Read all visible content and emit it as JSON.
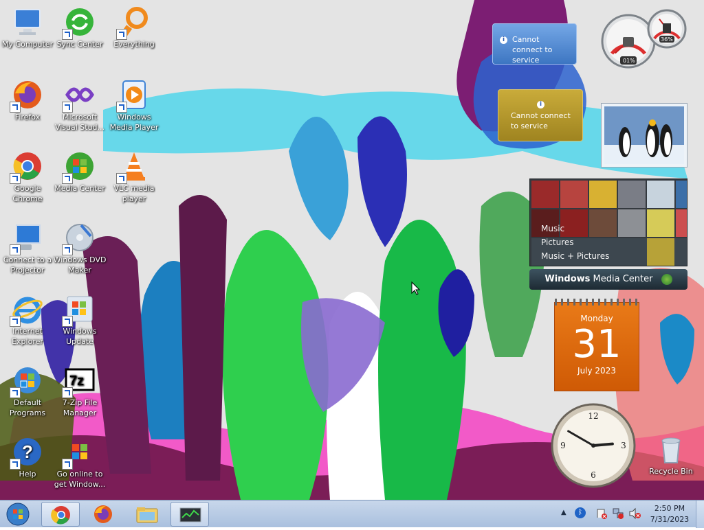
{
  "desktop_icons": [
    {
      "label": "My Computer",
      "icon": "computer-icon"
    },
    {
      "label": "Sync Center",
      "icon": "sync-icon"
    },
    {
      "label": "Everything",
      "icon": "search-ring-icon"
    },
    {
      "label": "Firefox",
      "icon": "firefox-icon"
    },
    {
      "label": "Microsoft Visual Stud...",
      "icon": "visual-studio-icon"
    },
    {
      "label": "Windows Media Player",
      "icon": "media-player-icon"
    },
    {
      "label": "Google Chrome",
      "icon": "chrome-icon"
    },
    {
      "label": "Media Center",
      "icon": "media-center-icon"
    },
    {
      "label": "VLC media player",
      "icon": "vlc-icon"
    },
    {
      "label": "Connect to a Projector",
      "icon": "projector-icon"
    },
    {
      "label": "Windows DVD Maker",
      "icon": "dvd-maker-icon"
    },
    {
      "label": "Internet Explorer",
      "icon": "internet-explorer-icon"
    },
    {
      "label": "Windows Update",
      "icon": "windows-update-icon"
    },
    {
      "label": "Default Programs",
      "icon": "default-programs-icon"
    },
    {
      "label": "7-Zip File Manager",
      "icon": "seven-zip-icon"
    },
    {
      "label": "Help",
      "icon": "help-icon"
    },
    {
      "label": "Go online to get Window...",
      "icon": "windows-online-icon"
    },
    {
      "label": "Recycle Bin",
      "icon": "recycle-bin-icon"
    }
  ],
  "gadgets": {
    "weather_notice": {
      "text": "Cannot connect to service",
      "icon": "info-icon"
    },
    "currency_notice": {
      "text": "Cannot connect to service",
      "icon": "info-icon"
    },
    "cpu_meter": {
      "cpu": "01%",
      "memory": "36%",
      "cpu_fraction": 0.01,
      "memory_fraction": 0.36
    },
    "media_center": {
      "items": [
        "Music",
        "Pictures",
        "Music + Pictures"
      ],
      "brand": "Windows",
      "brand_suffix": "Media Center"
    },
    "calendar": {
      "weekday": "Monday",
      "day": "31",
      "month_year": "July 2023"
    },
    "clock": {
      "hour": 2,
      "minute": 50
    }
  },
  "taskbar": {
    "start": "windows-start-icon",
    "pinned": [
      "chrome-icon",
      "firefox-icon",
      "explorer-folder-icon",
      "task-manager-icon"
    ],
    "tray_icons": [
      "show-hidden-icons-icon",
      "bluetooth-icon",
      "action-center-icon",
      "network-icon",
      "volume-muted-icon"
    ],
    "time": "2:50 PM",
    "date": "7/31/2023"
  },
  "colors": {
    "taskbar_bg": "#b7cbe6",
    "calendar_orange": "#e2650d",
    "notice_blue": "#4f8ad0",
    "notice_gold": "#b99a2a"
  }
}
